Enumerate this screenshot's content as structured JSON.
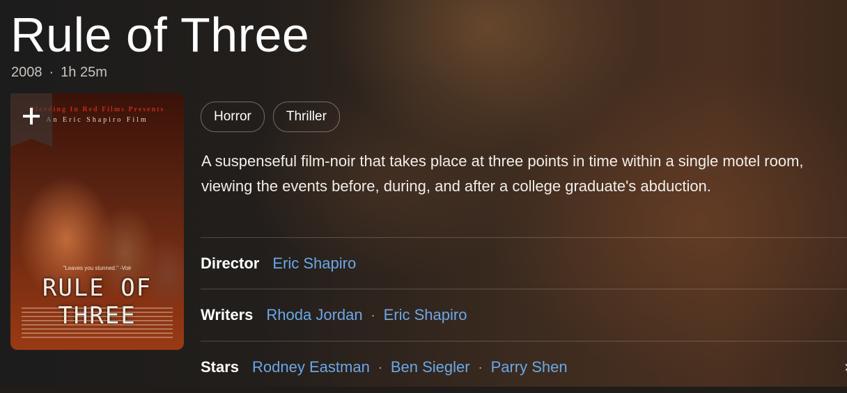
{
  "title": "Rule of Three",
  "meta": {
    "year": "2008",
    "runtime": "1h 25m"
  },
  "poster": {
    "presents": "Bleeding In Red Films Presents",
    "film_credit": "An Eric Shapiro Film",
    "quote": "\"Leaves you stunned.\" -Voir",
    "title_text": "RULE OF THREE",
    "watchlist_icon": "plus-icon"
  },
  "genres": [
    "Horror",
    "Thriller"
  ],
  "plot": "A suspenseful film-noir that takes place at three points in time within a single motel room, viewing the events before, during, and after a college graduate's abduction.",
  "credits": {
    "director_label": "Director",
    "directors": [
      "Eric Shapiro"
    ],
    "writers_label": "Writers",
    "writers": [
      "Rhoda Jordan",
      "Eric Shapiro"
    ],
    "stars_label": "Stars",
    "stars": [
      "Rodney Eastman",
      "Ben Siegler",
      "Parry Shen"
    ],
    "more_icon": "chevron-right-icon"
  },
  "colors": {
    "link": "#6aa8e8",
    "text_muted": "#c9c4c0"
  }
}
